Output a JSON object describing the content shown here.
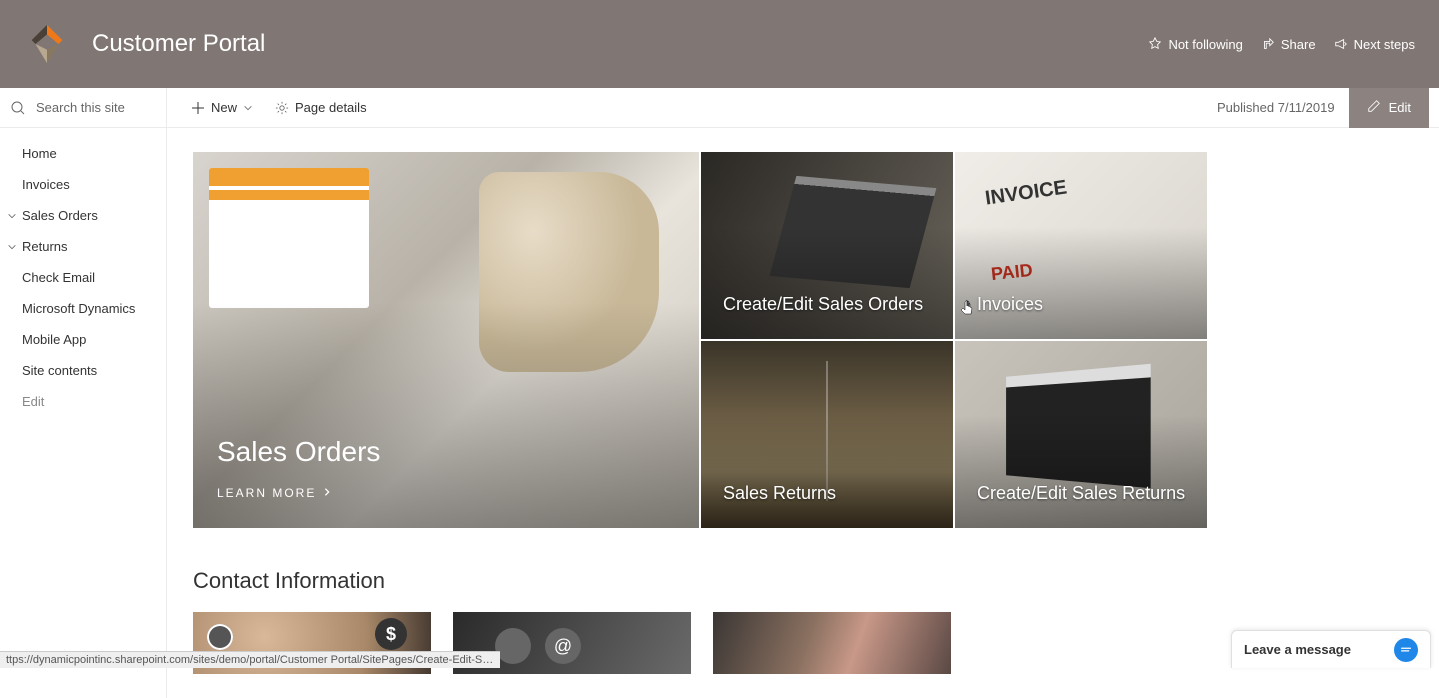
{
  "header": {
    "site_title": "Customer Portal",
    "not_following": "Not following",
    "share": "Share",
    "next_steps": "Next steps"
  },
  "commandbar": {
    "search_placeholder": "Search this site",
    "new_label": "New",
    "page_details": "Page details",
    "published": "Published 7/11/2019",
    "edit": "Edit"
  },
  "sidebar": {
    "items": [
      {
        "label": "Home",
        "chevron": false
      },
      {
        "label": "Invoices",
        "chevron": false
      },
      {
        "label": "Sales Orders",
        "chevron": true
      },
      {
        "label": "Returns",
        "chevron": true
      },
      {
        "label": "Check Email",
        "chevron": false
      },
      {
        "label": "Microsoft Dynamics",
        "chevron": false
      },
      {
        "label": "Mobile App",
        "chevron": false
      },
      {
        "label": "Site contents",
        "chevron": false
      },
      {
        "label": "Edit",
        "chevron": false
      }
    ]
  },
  "tiles": {
    "large": {
      "title": "Sales Orders",
      "learn_more": "LEARN MORE"
    },
    "small": [
      {
        "label": "Create/Edit Sales Orders"
      },
      {
        "label": "Invoices"
      },
      {
        "label": "Sales Returns"
      },
      {
        "label": "Create/Edit Sales Returns"
      }
    ]
  },
  "contact_section": {
    "title": "Contact Information"
  },
  "chat": {
    "label": "Leave a message"
  },
  "status_bar": {
    "url": "ttps://dynamicpointinc.sharepoint.com/sites/demo/portal/Customer Portal/SitePages/Create-Edit-Sales-Orders.aspx?..."
  }
}
